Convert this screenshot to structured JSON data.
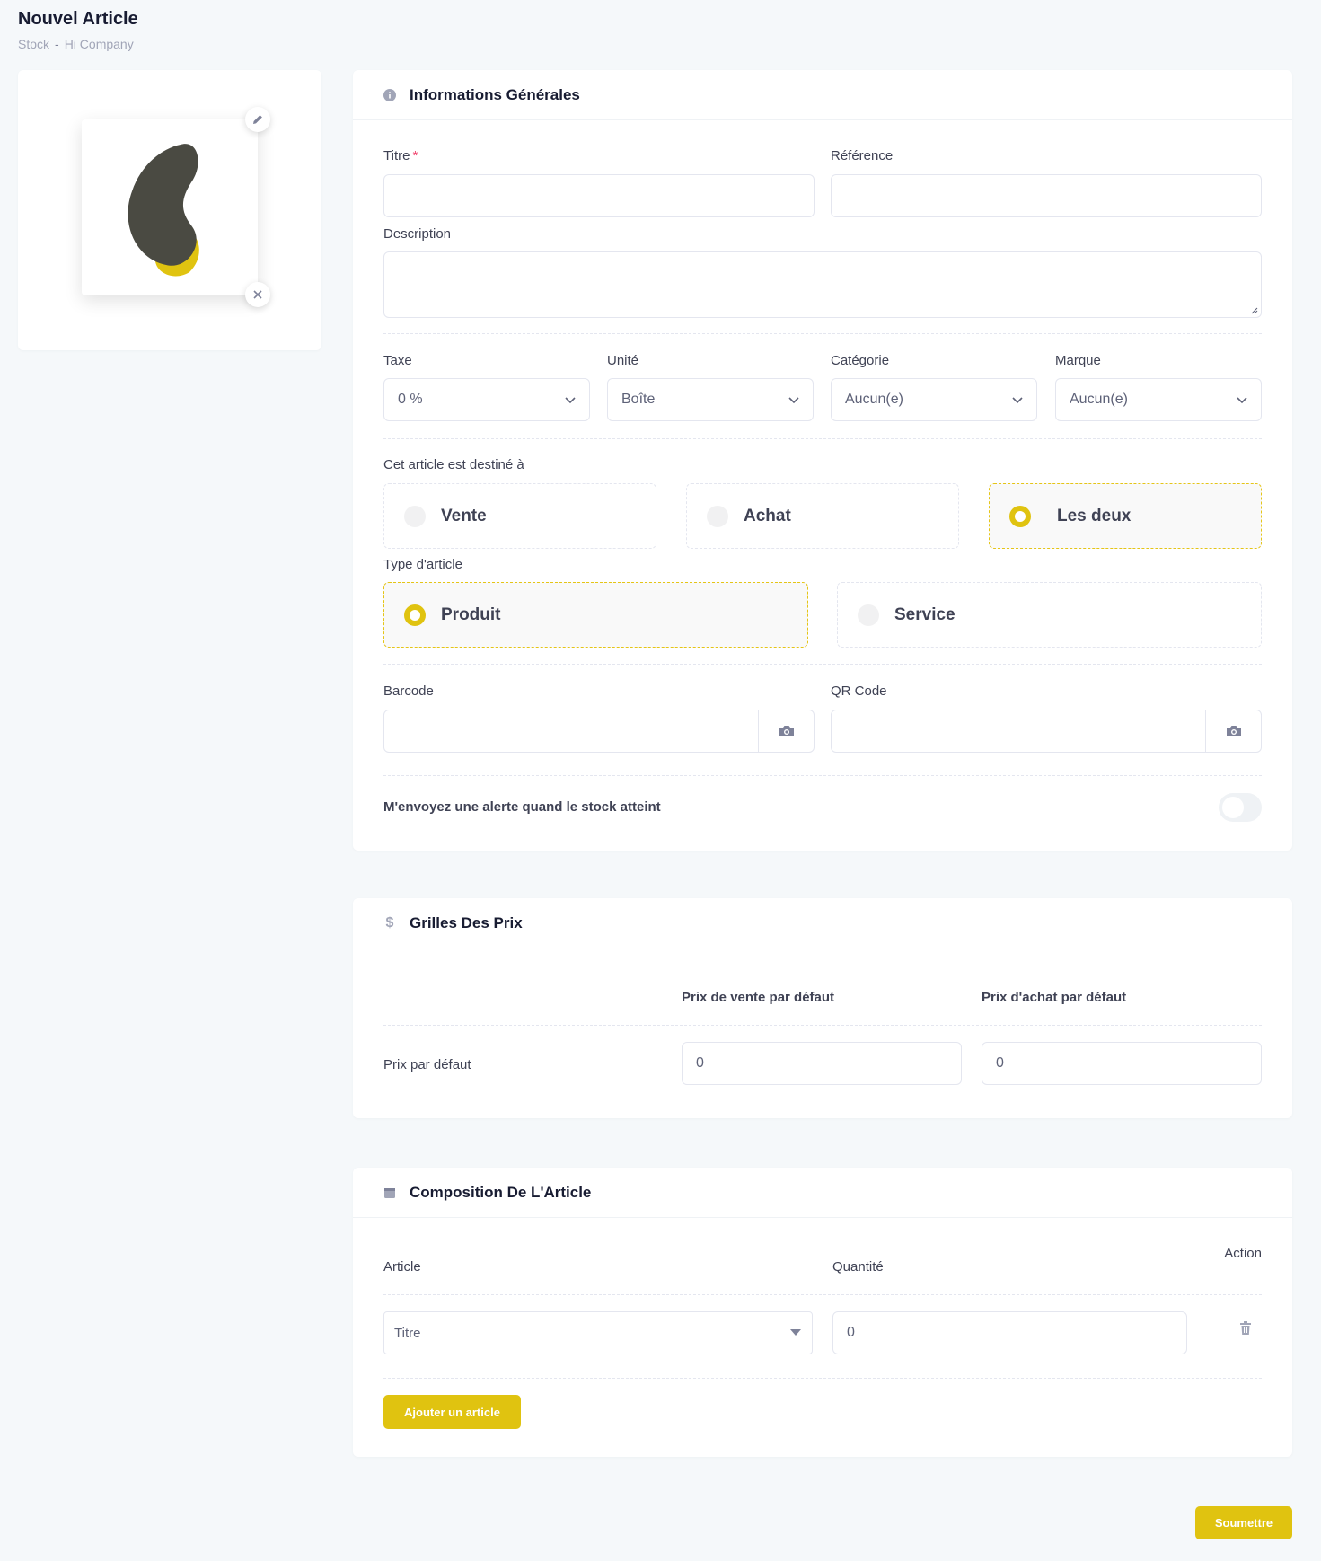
{
  "page": {
    "title": "Nouvel Article",
    "breadcrumb": [
      "Stock",
      "Hi Company"
    ],
    "breadcrumb_sep": "-"
  },
  "image_card": {
    "edit_icon": "pencil-icon",
    "remove_icon": "close-icon",
    "image_icon": "blob-logo-icon",
    "colors": {
      "dark": "#4a4a42",
      "yellow": "#e0c310"
    }
  },
  "general": {
    "title": "Informations Générales",
    "icon": "info-icon",
    "titre_label": "Titre",
    "titre_required": "*",
    "titre_value": "",
    "reference_label": "Référence",
    "reference_value": "",
    "description_label": "Description",
    "description_value": "",
    "taxe_label": "Taxe",
    "taxe_value": "0 %",
    "unite_label": "Unité",
    "unite_value": "Boîte",
    "categorie_label": "Catégorie",
    "categorie_value": "Aucun(e)",
    "marque_label": "Marque",
    "marque_value": "Aucun(e)",
    "destination_label": "Cet article est destiné à",
    "destination_options": [
      {
        "label": "Vente",
        "selected": false
      },
      {
        "label": "Achat",
        "selected": false
      },
      {
        "label": "Les deux",
        "selected": true
      }
    ],
    "type_label": "Type d'article",
    "type_options": [
      {
        "label": "Produit",
        "selected": true
      },
      {
        "label": "Service",
        "selected": false
      }
    ],
    "barcode_label": "Barcode",
    "barcode_value": "",
    "qrcode_label": "QR Code",
    "qrcode_value": "",
    "scan_icon": "camera-icon",
    "alert_label": "M'envoyez une alerte quand le stock atteint",
    "alert_enabled": false
  },
  "prices": {
    "title": "Grilles Des Prix",
    "icon": "dollar-icon",
    "col_sale": "Prix de vente par défaut",
    "col_purchase": "Prix d'achat par défaut",
    "row_label": "Prix par défaut",
    "sale_value": "0",
    "purchase_value": "0"
  },
  "composition": {
    "title": "Composition De L'Article",
    "icon": "calendar-icon",
    "col_article": "Article",
    "col_quantity": "Quantité",
    "col_action": "Action",
    "rows": [
      {
        "article": "Titre",
        "quantity": "0"
      }
    ],
    "delete_icon": "trash-icon",
    "add_button": "Ajouter un article"
  },
  "submit_button": "Soumettre",
  "accent_color": "#e0c310"
}
